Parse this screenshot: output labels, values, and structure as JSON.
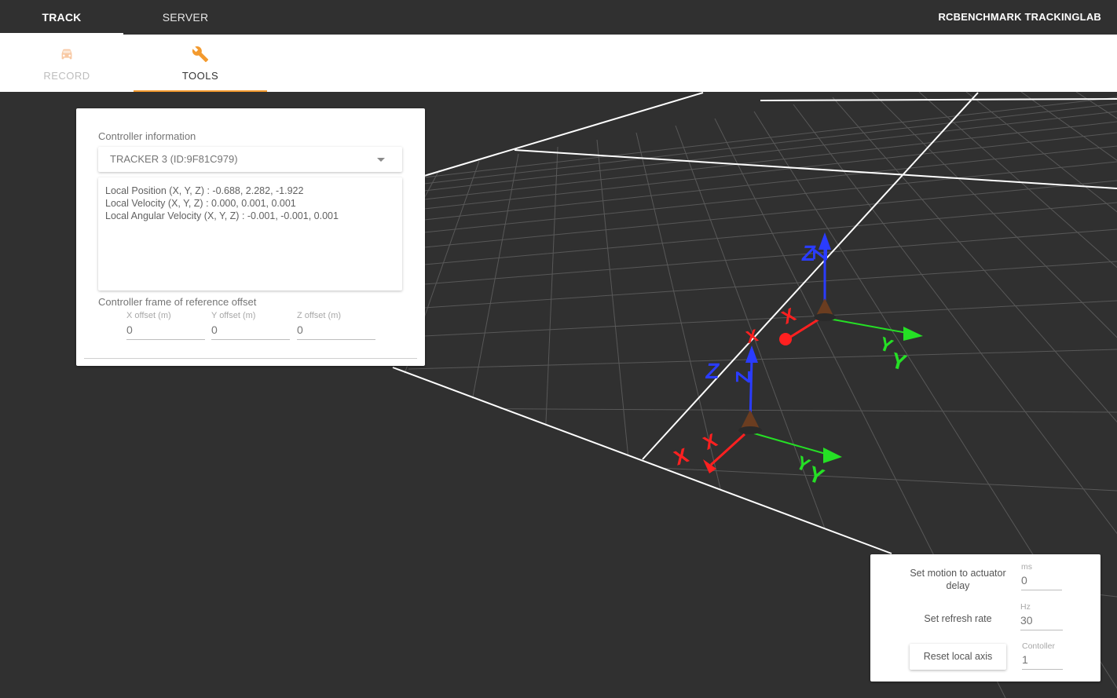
{
  "topbar": {
    "tabs": [
      {
        "label": "TRACK",
        "active": true
      },
      {
        "label": "SERVER",
        "active": false
      }
    ],
    "app_title": "RCBENCHMARK TRACKINGLAB"
  },
  "subtabs": [
    {
      "label": "RECORD",
      "icon": "car-icon",
      "active": false
    },
    {
      "label": "TOOLS",
      "icon": "wrench-icon",
      "active": true
    }
  ],
  "controller_card": {
    "title": "Controller information",
    "selected_tracker": "TRACKER 3 (ID:9F81C979)",
    "info_lines": [
      "Local Position (X, Y, Z) : -0.688, 2.282, -1.922",
      "Local Velocity (X, Y, Z) : 0.000, 0.001, 0.001",
      "Local Angular Velocity (X, Y, Z) : -0.001, -0.001, 0.001"
    ],
    "offset_title": "Controller frame of reference offset",
    "offsets": [
      {
        "label": "X offset (m)",
        "value": "0"
      },
      {
        "label": "Y offset (m)",
        "value": "0"
      },
      {
        "label": "Z offset (m)",
        "value": "0"
      }
    ]
  },
  "settings_panel": {
    "delay_label": "Set motion to actuator delay",
    "delay_unit": "ms",
    "delay_value": "0",
    "refresh_label": "Set refresh rate",
    "refresh_unit": "Hz",
    "refresh_value": "30",
    "reset_label": "Reset local axis",
    "controller_label": "Contoller",
    "controller_value": "1"
  },
  "scene": {
    "axis_labels": {
      "x": "X",
      "y": "Y",
      "z": "Z"
    },
    "colors": {
      "x": "#ff2020",
      "y": "#20e020",
      "z": "#2040ff",
      "grid": "#555555",
      "grid_major": "#ffffff",
      "background": "#303030"
    }
  }
}
